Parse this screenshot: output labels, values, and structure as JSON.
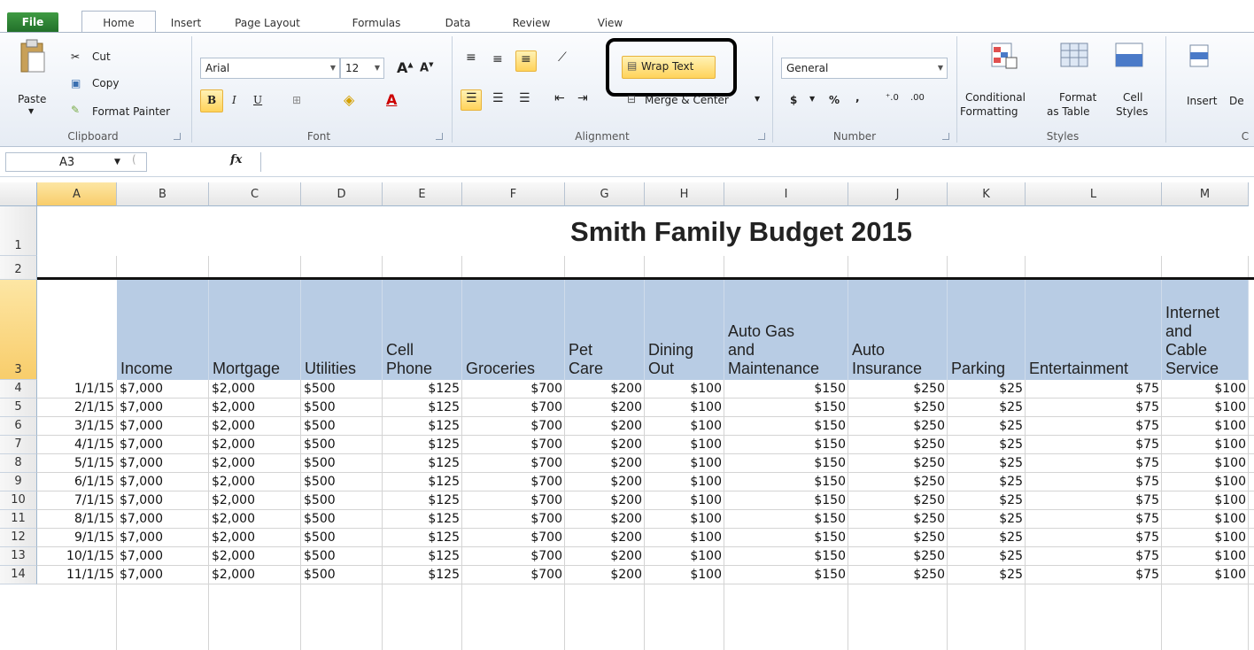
{
  "tabs": {
    "file": "File",
    "home": "Home",
    "insert": "Insert",
    "page_layout": "Page Layout",
    "formulas": "Formulas",
    "data": "Data",
    "review": "Review",
    "view": "View"
  },
  "clipboard": {
    "paste": "Paste",
    "cut": "Cut",
    "copy": "Copy",
    "format_painter": "Format Painter",
    "label": "Clipboard"
  },
  "font": {
    "name": "Arial",
    "size": "12",
    "label": "Font",
    "bold": "B",
    "italic": "I",
    "underline": "U"
  },
  "alignment": {
    "wrap_text": "Wrap Text",
    "merge_center": "Merge & Center",
    "label": "Alignment"
  },
  "number": {
    "format": "General",
    "currency": "$",
    "percent": "%",
    "comma": ",",
    "label": "Number"
  },
  "styles": {
    "conditional": "Conditional",
    "conditional2": "Formatting",
    "format_table": "Format",
    "format_table2": "as Table",
    "cell_styles": "Cell",
    "cell_styles2": "Styles",
    "label": "Styles"
  },
  "cells": {
    "insert": "Insert",
    "delete": "De",
    "label": "C"
  },
  "formula_bar": {
    "name_box": "A3",
    "fx": "fx",
    "value": ""
  },
  "sheet": {
    "title": "Smith Family Budget 2015",
    "columns": [
      "A",
      "B",
      "C",
      "D",
      "E",
      "F",
      "G",
      "H",
      "I",
      "J",
      "K",
      "L",
      "M"
    ],
    "selected_column": "A",
    "headers": [
      {
        "col": "B",
        "lines": [
          "Income"
        ]
      },
      {
        "col": "C",
        "lines": [
          "Mortgage"
        ]
      },
      {
        "col": "D",
        "lines": [
          "Utilities"
        ]
      },
      {
        "col": "E",
        "lines": [
          "Cell",
          "Phone"
        ]
      },
      {
        "col": "F",
        "lines": [
          "Groceries"
        ]
      },
      {
        "col": "G",
        "lines": [
          "Pet",
          "Care"
        ]
      },
      {
        "col": "H",
        "lines": [
          "Dining",
          "Out"
        ]
      },
      {
        "col": "I",
        "lines": [
          "Auto Gas",
          "and",
          "Maintenance"
        ]
      },
      {
        "col": "J",
        "lines": [
          "Auto",
          "Insurance"
        ]
      },
      {
        "col": "K",
        "lines": [
          "Parking"
        ]
      },
      {
        "col": "L",
        "lines": [
          "Entertainment"
        ]
      },
      {
        "col": "M",
        "lines": [
          "Internet",
          "and",
          "Cable",
          "Service"
        ]
      }
    ],
    "rows": [
      {
        "n": "4",
        "date": "1/1/15",
        "values": [
          "$7,000",
          "$2,000",
          "$500",
          "$125",
          "$700",
          "$200",
          "$100",
          "$150",
          "$250",
          "$25",
          "$75",
          "$100"
        ]
      },
      {
        "n": "5",
        "date": "2/1/15",
        "values": [
          "$7,000",
          "$2,000",
          "$500",
          "$125",
          "$700",
          "$200",
          "$100",
          "$150",
          "$250",
          "$25",
          "$75",
          "$100"
        ]
      },
      {
        "n": "6",
        "date": "3/1/15",
        "values": [
          "$7,000",
          "$2,000",
          "$500",
          "$125",
          "$700",
          "$200",
          "$100",
          "$150",
          "$250",
          "$25",
          "$75",
          "$100"
        ]
      },
      {
        "n": "7",
        "date": "4/1/15",
        "values": [
          "$7,000",
          "$2,000",
          "$500",
          "$125",
          "$700",
          "$200",
          "$100",
          "$150",
          "$250",
          "$25",
          "$75",
          "$100"
        ]
      },
      {
        "n": "8",
        "date": "5/1/15",
        "values": [
          "$7,000",
          "$2,000",
          "$500",
          "$125",
          "$700",
          "$200",
          "$100",
          "$150",
          "$250",
          "$25",
          "$75",
          "$100"
        ]
      },
      {
        "n": "9",
        "date": "6/1/15",
        "values": [
          "$7,000",
          "$2,000",
          "$500",
          "$125",
          "$700",
          "$200",
          "$100",
          "$150",
          "$250",
          "$25",
          "$75",
          "$100"
        ]
      },
      {
        "n": "10",
        "date": "7/1/15",
        "values": [
          "$7,000",
          "$2,000",
          "$500",
          "$125",
          "$700",
          "$200",
          "$100",
          "$150",
          "$250",
          "$25",
          "$75",
          "$100"
        ]
      },
      {
        "n": "11",
        "date": "8/1/15",
        "values": [
          "$7,000",
          "$2,000",
          "$500",
          "$125",
          "$700",
          "$200",
          "$100",
          "$150",
          "$250",
          "$25",
          "$75",
          "$100"
        ]
      },
      {
        "n": "12",
        "date": "9/1/15",
        "values": [
          "$7,000",
          "$2,000",
          "$500",
          "$125",
          "$700",
          "$200",
          "$100",
          "$150",
          "$250",
          "$25",
          "$75",
          "$100"
        ]
      },
      {
        "n": "13",
        "date": "10/1/15",
        "values": [
          "$7,000",
          "$2,000",
          "$500",
          "$125",
          "$700",
          "$200",
          "$100",
          "$150",
          "$250",
          "$25",
          "$75",
          "$100"
        ]
      },
      {
        "n": "14",
        "date": "11/1/15",
        "values": [
          "$7,000",
          "$2,000",
          "$500",
          "$125",
          "$700",
          "$200",
          "$100",
          "$150",
          "$250",
          "$25",
          "$75",
          "$100"
        ]
      }
    ]
  },
  "colors": {
    "header_fill": "#b8cce4",
    "highlight": "#ffd35a",
    "file_tab": "#2d7d32"
  }
}
